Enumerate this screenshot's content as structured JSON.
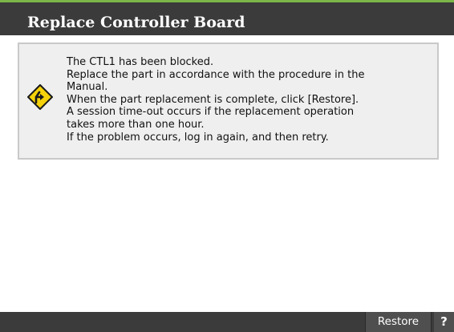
{
  "dialog": {
    "title": "Replace Controller Board"
  },
  "message": {
    "icon": "warning-icon",
    "lines": [
      "The CTL1 has been blocked.",
      "Replace the part in accordance with the procedure in the",
      "Manual.",
      "When the part replacement is complete, click [Restore].",
      "A session time-out occurs if the replacement operation",
      "takes more than one hour.",
      "If the problem occurs, log in again, and then retry."
    ]
  },
  "footer": {
    "restore_label": "Restore",
    "help_label": "?"
  },
  "colors": {
    "titlebar": "#3b3b3b",
    "accent": "#7ab648",
    "warning_fill": "#f5d20a"
  }
}
